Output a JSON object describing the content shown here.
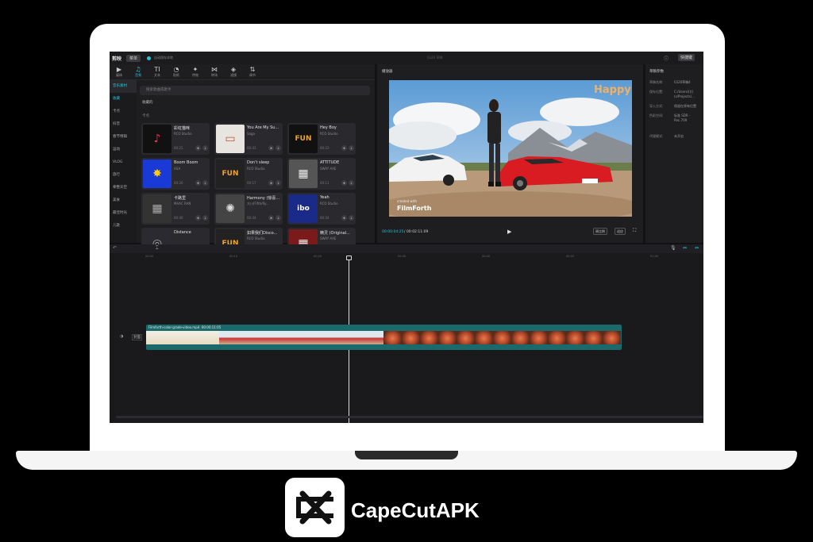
{
  "app": {
    "logo_text": "剪映",
    "menu_label": "菜单",
    "autosave_text": "自动保存本地",
    "window_title": "0320 草稿",
    "shortcut_label": "快捷键",
    "accent_color": "#1fc7d8"
  },
  "toolbar": [
    {
      "glyph": "▶",
      "label": "媒体",
      "icon": "media-icon"
    },
    {
      "glyph": "♫",
      "label": "音频",
      "icon": "audio-icon",
      "active": true
    },
    {
      "glyph": "TI",
      "label": "文本",
      "icon": "text-icon"
    },
    {
      "glyph": "◔",
      "label": "贴纸",
      "icon": "sticker-icon"
    },
    {
      "glyph": "✦",
      "label": "特效",
      "icon": "effects-icon"
    },
    {
      "glyph": "⋈",
      "label": "转场",
      "icon": "transition-icon"
    },
    {
      "glyph": "◈",
      "label": "滤镜",
      "icon": "filter-icon"
    },
    {
      "glyph": "⇅",
      "label": "调节",
      "icon": "adjust-icon"
    }
  ],
  "categories": [
    "音乐素材",
    "收藏",
    "卡点",
    "抖音",
    "春节特辑",
    "运动",
    "VLOG",
    "旅行",
    "拳整天空",
    "美食",
    "最佳时光",
    "儿歌"
  ],
  "search_placeholder": "搜索歌曲或歌手",
  "sub_heading": "收藏的",
  "sub_heading2": "卡点",
  "songs": [
    {
      "title": "彩虹猫咪",
      "artist": "RCO Studio",
      "duration": "00:21"
    },
    {
      "title": "You Are My Su...",
      "artist": "Saga",
      "duration": "00:33"
    },
    {
      "title": "Hey Boy",
      "artist": "RCO Studio",
      "duration": "00:23"
    },
    {
      "title": "Boom Boom",
      "artist": "ASA",
      "duration": "00:20"
    },
    {
      "title": "Don't sleep",
      "artist": "RCO Studio",
      "duration": "00:17"
    },
    {
      "title": "ATTITUDE",
      "artist": "SWAY AXE",
      "duration": "00:11"
    },
    {
      "title": "卡路里",
      "artist": "MAAC RAN",
      "duration": "00:40"
    },
    {
      "title": "Harmony (惊喜...",
      "artist": "大川(Fifth/Ry...",
      "duration": "00:34"
    },
    {
      "title": "Yeah",
      "artist": "RCO Studio",
      "duration": "00:34"
    },
    {
      "title": "Distance",
      "artist": "",
      "duration": ""
    },
    {
      "title": "如果我们Disco...",
      "artist": "RCO Studio",
      "duration": ""
    },
    {
      "title": "精灵 (Original...",
      "artist": "SWAY AXE",
      "duration": ""
    }
  ],
  "player": {
    "label": "播放器",
    "overlay_text": "Happy",
    "watermark": "FilmForth",
    "watermark_sub": "created with",
    "current_time": "00:00:04:25",
    "total_time": "/ 00:02:11:09",
    "btn_original": "原比例",
    "btn_ratio": "适应"
  },
  "properties": {
    "title": "草稿参数",
    "rows": [
      {
        "label": "草稿名称:",
        "value": "0320草稿4"
      },
      {
        "label": "保存位置:",
        "value": "C:/Users/(((( (s/Projects/..."
      },
      {
        "label": "导入方式:",
        "value": "保留在原有位置"
      },
      {
        "label": "色彩空间:",
        "value": "标准 SDR - Rec.709"
      },
      {
        "label": "代理模式:",
        "value": "未开启"
      }
    ]
  },
  "timeline": {
    "ticks": [
      "00:00",
      "00:10",
      "00:20",
      "00:30",
      "00:40",
      "00:50",
      "01:00"
    ],
    "clip_name": "Filmforth-color-grade-video.mp4",
    "clip_duration": "00:00:11:05",
    "cover_label": "封面"
  },
  "brand": {
    "name": "CapeCutAPK"
  }
}
